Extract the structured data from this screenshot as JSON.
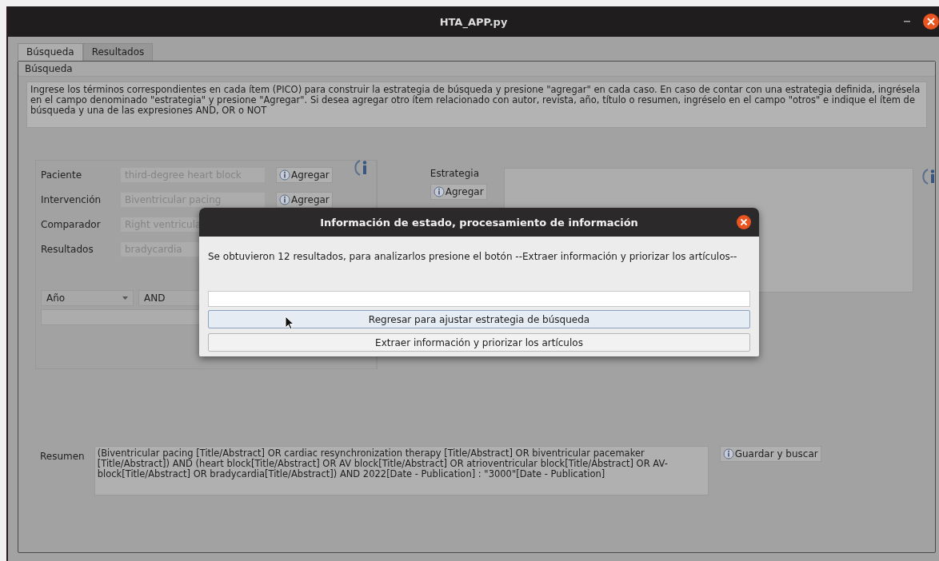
{
  "window": {
    "title": "HTA_APP.py"
  },
  "tabs": [
    {
      "label": "Búsqueda",
      "selected": true
    },
    {
      "label": "Resultados",
      "selected": false
    }
  ],
  "group": {
    "title": "Búsqueda",
    "instructions": "Ingrese los términos correspondientes en cada ítem (PICO) para construir la estrategia de búsqueda y presione \"agregar\" en cada caso. En caso de contar con una estrategia definida, ingrésela en el campo denominado \"estrategia\" y presione \"Agregar\". Si desea agregar otro ítem relacionado con autor, revista, año, título o resumen, ingréselo en el campo \"otros\" e indique el ítem de búsqueda y una de las expresiones AND, OR o NOT"
  },
  "pico": [
    {
      "label": "Paciente",
      "value": "third-degree heart block",
      "button": "Agregar"
    },
    {
      "label": "Intervención",
      "value": "Biventricular pacing",
      "button": "Agregar"
    },
    {
      "label": "Comparador",
      "value": "Right ventricula"
    },
    {
      "label": "Resultados",
      "value": "bradycardia"
    }
  ],
  "filter": {
    "field": "Año",
    "operator": "AND"
  },
  "strategy": {
    "label": "Estrategia",
    "button": "Agregar"
  },
  "summary": {
    "label": "Resumen",
    "text": "(Biventricular pacing [Title/Abstract] OR cardiac resynchronization therapy [Title/Abstract] OR biventricular pacemaker [Title/Abstract]) AND (heart block[Title/Abstract] OR AV block[Title/Abstract] OR atrioventricular block[Title/Abstract] OR AV-block[Title/Abstract] OR bradycardia[Title/Abstract]) AND 2022[Date - Publication] : \"3000\"[Date - Publication]",
    "button": "Guardar y buscar"
  },
  "dialog": {
    "title": "Información de estado, procesamiento de información",
    "message": "Se obtuvieron 12 resultados, para analizarlos presione el botón --Extraer información y priorizar los artículos--",
    "buttons": [
      {
        "label": "Regresar para ajustar estrategia de búsqueda",
        "hovered": true
      },
      {
        "label": "Extraer información y priorizar los artículos",
        "hovered": false
      }
    ]
  }
}
